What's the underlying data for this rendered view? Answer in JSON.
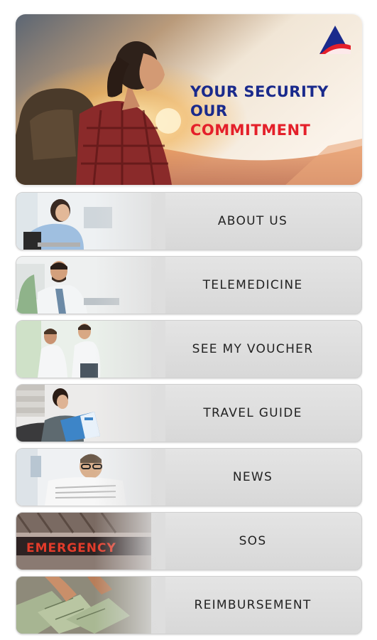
{
  "hero": {
    "line1": "YOUR SECURITY",
    "line2": "OUR",
    "line3": "COMMITMENT",
    "colors": {
      "primary": "#1a2a8c",
      "accent": "#e4202a"
    }
  },
  "menu": {
    "items": [
      {
        "label": "ABOUT US",
        "icon": "office-woman-photo"
      },
      {
        "label": "TELEMEDICINE",
        "icon": "doctor-photo"
      },
      {
        "label": "SEE MY VOUCHER",
        "icon": "doctors-walking-photo"
      },
      {
        "label": "TRAVEL GUIDE",
        "icon": "woman-reading-photo"
      },
      {
        "label": "NEWS",
        "icon": "man-reading-newspaper-photo"
      },
      {
        "label": "SOS",
        "icon": "emergency-sign-photo"
      },
      {
        "label": "REIMBURSEMENT",
        "icon": "money-hands-photo"
      }
    ]
  }
}
